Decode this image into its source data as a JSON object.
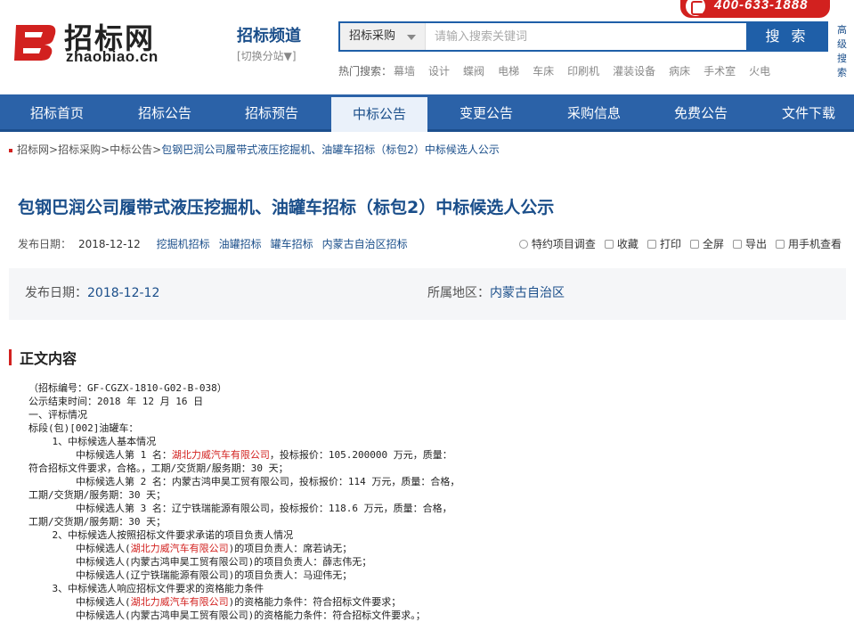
{
  "header": {
    "logo_cn": "招标网",
    "logo_en": "zhaobiao.cn",
    "channel_title": "招标频道",
    "channel_switch": "[切换分站▼]",
    "phone": "400-633-1888",
    "side_link_1": "高级",
    "side_link_2": "搜索"
  },
  "search": {
    "category": "招标采购",
    "placeholder": "请输入搜索关键词",
    "button": "搜 索"
  },
  "hot": {
    "label": "热门搜索：",
    "keywords": [
      "幕墙",
      "设计",
      "蝶阀",
      "电梯",
      "车床",
      "印刷机",
      "灌装设备",
      "病床",
      "手术室",
      "火电"
    ]
  },
  "nav": {
    "items": [
      "招标首页",
      "招标公告",
      "招标预告",
      "中标公告",
      "变更公告",
      "采购信息",
      "免费公告",
      "文件下载"
    ],
    "active": "中标公告"
  },
  "breadcrumb": {
    "items": [
      "招标网",
      "招标采购",
      "中标公告"
    ],
    "separator": ">",
    "current": "包钢巴润公司履带式液压挖掘机、油罐车招标（标包2）中标候选人公示"
  },
  "article": {
    "title": "包钢巴润公司履带式液压挖掘机、油罐车招标（标包2）中标候选人公示",
    "date_label": "发布日期：",
    "date": "2018-12-12",
    "tags": [
      "挖掘机招标",
      "油罐招标",
      "罐车招标",
      "内蒙古自治区招标"
    ]
  },
  "tools": {
    "items": [
      "特约项目调查",
      "收藏",
      "打印",
      "全屏",
      "导出",
      "用手机查看"
    ]
  },
  "info": {
    "date_label": "发布日期：",
    "date": "2018-12-12",
    "region_label": "所属地区：",
    "region": "内蒙古自治区"
  },
  "section": {
    "title": "正文内容"
  },
  "content": {
    "lines": [
      [
        {
          "t": "（招标编号：GF-CGZX-1810-G02-B-038）"
        }
      ],
      [
        {
          "t": "公示结束时间：2018 年 12 月 16 日"
        }
      ],
      [
        {
          "t": "一、评标情况"
        }
      ],
      [
        {
          "t": "标段(包)[002]油罐车："
        }
      ],
      [
        {
          "t": "    1、中标候选人基本情况"
        }
      ],
      [
        {
          "t": "        中标候选人第 1 名："
        },
        {
          "t": "湖北力威汽车有限公司",
          "red": true
        },
        {
          "t": "，投标报价：105.200000 万元，质量："
        }
      ],
      [
        {
          "t": "符合招标文件要求，合格。，工期/交货期/服务期：30 天；"
        }
      ],
      [
        {
          "t": "        中标候选人第 2 名：内蒙古鸿申昊工贸有限公司，投标报价：114 万元，质量：合格，"
        }
      ],
      [
        {
          "t": "工期/交货期/服务期：30 天；"
        }
      ],
      [
        {
          "t": "        中标候选人第 3 名：辽宁铁瑞能源有限公司，投标报价：118.6 万元，质量：合格，"
        }
      ],
      [
        {
          "t": "工期/交货期/服务期：30 天；"
        }
      ],
      [
        {
          "t": "    2、中标候选人按照招标文件要求承诺的项目负责人情况"
        }
      ],
      [
        {
          "t": "        中标候选人("
        },
        {
          "t": "湖北力威汽车有限公司",
          "red": true
        },
        {
          "t": ")的项目负责人：席若讷无；"
        }
      ],
      [
        {
          "t": "        中标候选人(内蒙古鸿申昊工贸有限公司)的项目负责人：薛志伟无；"
        }
      ],
      [
        {
          "t": "        中标候选人(辽宁铁瑞能源有限公司)的项目负责人：马迎伟无；"
        }
      ],
      [
        {
          "t": "    3、中标候选人响应招标文件要求的资格能力条件"
        }
      ],
      [
        {
          "t": "        中标候选人("
        },
        {
          "t": "湖北力威汽车有限公司",
          "red": true
        },
        {
          "t": ")的资格能力条件：符合招标文件要求；"
        }
      ],
      [
        {
          "t": "        中标候选人(内蒙古鸿申昊工贸有限公司)的资格能力条件：符合招标文件要求。；"
        }
      ]
    ]
  },
  "colors": {
    "brand_blue": "#2b62a8",
    "title_blue": "#1a4e8a",
    "accent_red": "#d2211f"
  }
}
